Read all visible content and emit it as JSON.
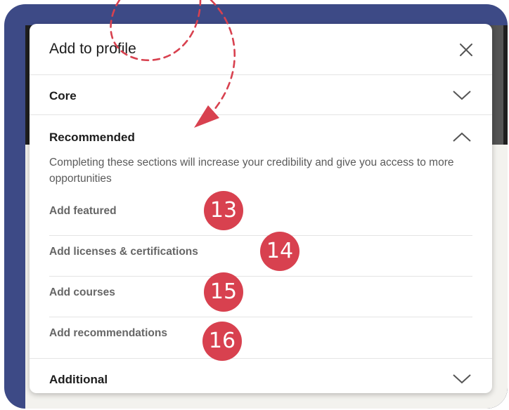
{
  "modal": {
    "title": "Add to profile",
    "close_icon": "close-icon"
  },
  "sections": {
    "core": {
      "label": "Core",
      "icon": "chevron-down-icon"
    },
    "recommended": {
      "label": "Recommended",
      "icon": "chevron-up-icon",
      "description": "Completing these sections will increase your credibility and give you access to more opportunities",
      "items": [
        {
          "label": "Add featured"
        },
        {
          "label": "Add licenses & certifications"
        },
        {
          "label": "Add courses"
        },
        {
          "label": "Add recommendations"
        }
      ]
    },
    "additional": {
      "label": "Additional",
      "icon": "chevron-down-icon"
    }
  },
  "badges": [
    {
      "number": "13"
    },
    {
      "number": "14"
    },
    {
      "number": "15"
    },
    {
      "number": "16"
    }
  ],
  "colors": {
    "frame": "#3d4a86",
    "badge": "#d8414f",
    "annotation_arrow": "#d8414f"
  }
}
